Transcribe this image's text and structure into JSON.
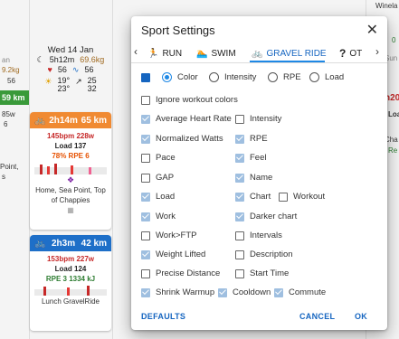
{
  "calendar": {
    "left_fragment": {
      "line1": "an",
      "line2": "9.2kg",
      "line3": "56",
      "badge": "59 km",
      "line4": "85w",
      "line5": "6",
      "line6": "Point,",
      "line7": "s"
    },
    "day": {
      "date": "Wed 14 Jan",
      "sleep": "5h12m",
      "weight": "69.6kg",
      "hr": "56",
      "hrv": "56",
      "weather_low": "19°",
      "weather_high": "23°",
      "wind_a": "25",
      "wind_b": "32"
    },
    "card1": {
      "duration": "2h14m",
      "distance": "65 km",
      "hr_power": "145bpm 228w",
      "load": "Load 137",
      "intensity_rpe": "78% RPE 6",
      "title": "Home, Sea Point, Top of Chappies",
      "color": "#f08a32"
    },
    "card2": {
      "duration": "2h3m",
      "distance": "42 km",
      "hr_power": "153bpm 227w",
      "load": "Load 124",
      "rpe_kj": "RPE 3  1334 kJ",
      "title": "Lunch GravelRide",
      "color": "#1e6fc8"
    },
    "right_fragment": {
      "line1": "Winela",
      "line2": "Sun",
      "line3": "h20",
      "line4": "Loa",
      "line5": "Cha",
      "line6": "Re",
      "line7": "0"
    }
  },
  "dialog": {
    "title": "Sport Settings",
    "tabs": [
      {
        "label": "RUN",
        "icon": "run-icon"
      },
      {
        "label": "SWIM",
        "icon": "swim-icon"
      },
      {
        "label": "GRAVEL RIDE",
        "icon": "bike-icon"
      },
      {
        "label": "OT",
        "icon": "question-icon"
      }
    ],
    "color_modes": [
      "Color",
      "Intensity",
      "RPE",
      "Load"
    ],
    "selected_color_mode": "Color",
    "options_left": [
      {
        "label": "Ignore workout colors",
        "checked": false
      },
      {
        "label": "Average Heart Rate",
        "checked": true
      },
      {
        "label": "Normalized Watts",
        "checked": true
      },
      {
        "label": "Pace",
        "checked": false
      },
      {
        "label": "GAP",
        "checked": false
      },
      {
        "label": "Load",
        "checked": true
      },
      {
        "label": "Work",
        "checked": true
      },
      {
        "label": "Work>FTP",
        "checked": false
      },
      {
        "label": "Weight Lifted",
        "checked": true
      },
      {
        "label": "Precise Distance",
        "checked": false
      },
      {
        "label": "Shrink Warmup",
        "checked": true
      }
    ],
    "options_right": [
      {
        "label": "Intensity",
        "checked": false
      },
      {
        "label": "RPE",
        "checked": true
      },
      {
        "label": "Feel",
        "checked": true
      },
      {
        "label": "Name",
        "checked": true
      },
      {
        "label": "Chart",
        "checked": true
      },
      {
        "label": "Darker chart",
        "checked": true
      },
      {
        "label": "Intervals",
        "checked": false
      },
      {
        "label": "Description",
        "checked": false
      },
      {
        "label": "Start Time",
        "checked": false
      },
      {
        "label": "Cooldown",
        "checked": true
      }
    ],
    "workout_option": {
      "label": "Workout",
      "checked": false
    },
    "commute_option": {
      "label": "Commute",
      "checked": true
    },
    "buttons": {
      "defaults": "DEFAULTS",
      "cancel": "CANCEL",
      "ok": "OK"
    },
    "accent": "#1565c0"
  }
}
